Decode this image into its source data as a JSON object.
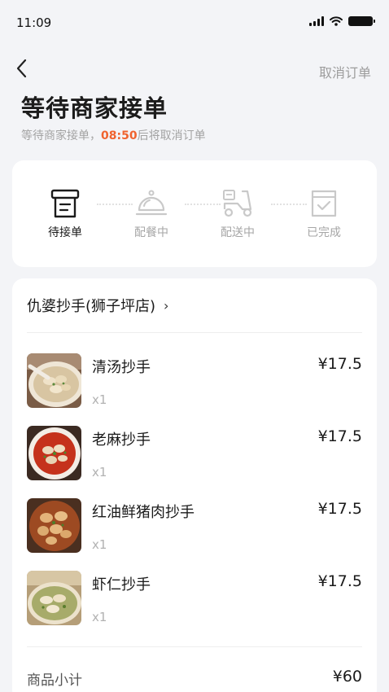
{
  "status_bar": {
    "time": "11:09"
  },
  "nav": {
    "cancel_label": "取消订单"
  },
  "header": {
    "title": "等待商家接单",
    "subtitle_prefix": "等待商家接单，",
    "countdown": "08:50",
    "subtitle_suffix": "后将取消订单"
  },
  "steps": [
    {
      "label": "待接单",
      "icon": "pending-order-icon",
      "active": true
    },
    {
      "label": "配餐中",
      "icon": "food-cloche-icon",
      "active": false
    },
    {
      "label": "配送中",
      "icon": "delivery-scooter-icon",
      "active": false
    },
    {
      "label": "已完成",
      "icon": "completed-bag-icon",
      "active": false
    }
  ],
  "shop": {
    "name": "仇婆抄手(狮子坪店)",
    "chevron": "›"
  },
  "items": [
    {
      "name": "清汤抄手",
      "qty": "x1",
      "price": "¥17.5"
    },
    {
      "name": "老麻抄手",
      "qty": "x1",
      "price": "¥17.5"
    },
    {
      "name": "红油鲜猪肉抄手",
      "qty": "x1",
      "price": "¥17.5"
    },
    {
      "name": "虾仁抄手",
      "qty": "x1",
      "price": "¥17.5"
    }
  ],
  "summary": {
    "subtotal_label": "商品小计",
    "subtotal_value": "¥60"
  },
  "colors": {
    "accent": "#f0632e",
    "background": "#f3f4f7"
  }
}
